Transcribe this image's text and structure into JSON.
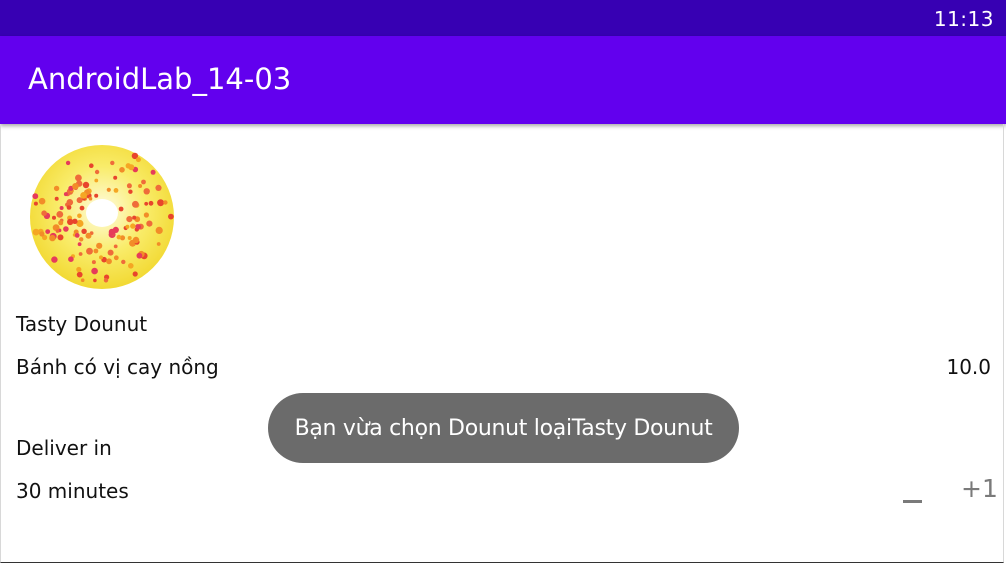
{
  "status_bar": {
    "time": "11:13"
  },
  "app_bar": {
    "title": "AndroidLab_14-03"
  },
  "product": {
    "image_icon": "donut-image",
    "name": "Tasty Dounut",
    "description": "Bánh có vị cay nồng",
    "price": "10.0",
    "deliver_label": "Deliver in",
    "deliver_time": "30 minutes"
  },
  "stepper": {
    "minus_label": "—",
    "plus_label": "+1"
  },
  "toast": {
    "message": "Bạn vừa chọn Dounut loạiTasty Dounut"
  },
  "colors": {
    "status_bar": "#3700b3",
    "app_bar": "#6200ee",
    "toast": "#6b6b6b",
    "donut_icing": "#f7e64a"
  }
}
